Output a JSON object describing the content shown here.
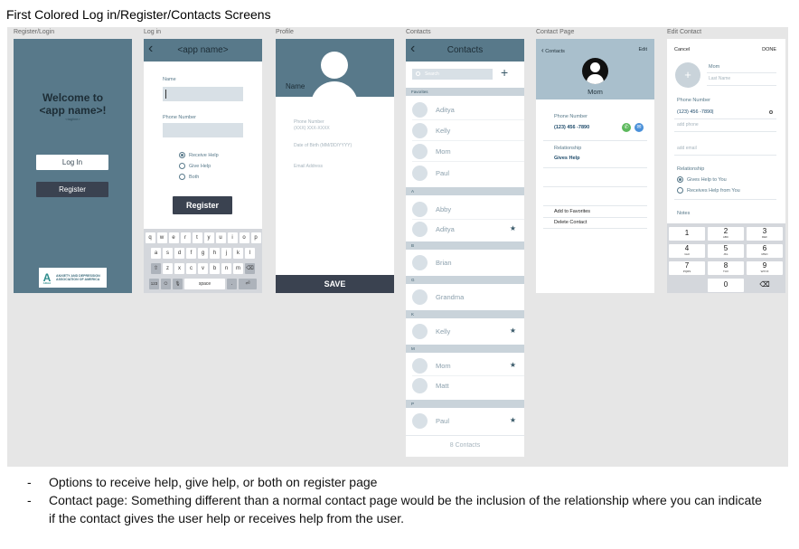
{
  "page_title": "First Colored Log in/Register/Contacts Screens",
  "frames": {
    "register_login": "Register/Login",
    "login": "Log in",
    "profile": "Profile",
    "contacts": "Contacts",
    "contact_page": "Contact Page",
    "edit_contact": "Edit Contact"
  },
  "register_login": {
    "welcome_line1": "Welcome to",
    "welcome_line2": "<app name>!",
    "tagline": "<tagline>",
    "login_button": "Log In",
    "register_button": "Register",
    "logo_mark": "A",
    "logo_text_1": "ANXIETY AND DEPRESSION",
    "logo_text_2": "ASSOCIATION OF AMERICA",
    "logo_caption": "ADAA"
  },
  "login": {
    "header_title": "<app name>",
    "name_label": "Name",
    "phone_label": "Phone Number",
    "radio_options": [
      "Receive Help",
      "Give Help",
      "Both"
    ],
    "register_button": "Register",
    "keyboard": {
      "row1": [
        "q",
        "w",
        "e",
        "r",
        "t",
        "y",
        "u",
        "i",
        "o",
        "p"
      ],
      "row2": [
        "a",
        "s",
        "d",
        "f",
        "g",
        "h",
        "j",
        "k",
        "l"
      ],
      "row3": [
        "z",
        "x",
        "c",
        "v",
        "b",
        "n",
        "m"
      ],
      "shift": "⇧",
      "delete": "⌫",
      "num": "123",
      "emoji": "☺",
      "mic": "🎙",
      "space": "space",
      "period": ".",
      "return": "⏎"
    }
  },
  "profile": {
    "name": "Name",
    "phone_label": "Phone Number",
    "phone_placeholder": "(XXX) XXX-XXXX",
    "dob": "Date of Birth (MM/DD/YYYY)",
    "email": "Email Address",
    "save_button": "SAVE"
  },
  "contacts": {
    "header_title": "Contacts",
    "search_placeholder": "Search",
    "add": "+",
    "sections": [
      {
        "letter": "Favorites",
        "rows": [
          {
            "name": "Aditya",
            "star": ""
          },
          {
            "name": "Kelly",
            "star": ""
          },
          {
            "name": "Mom",
            "star": ""
          },
          {
            "name": "Paul",
            "star": ""
          }
        ]
      },
      {
        "letter": "A",
        "rows": [
          {
            "name": "Abby",
            "star": ""
          },
          {
            "name": "Aditya",
            "star": "★"
          }
        ]
      },
      {
        "letter": "B",
        "rows": [
          {
            "name": "Brian",
            "star": ""
          }
        ]
      },
      {
        "letter": "G",
        "rows": [
          {
            "name": "Grandma",
            "star": ""
          }
        ]
      },
      {
        "letter": "K",
        "rows": [
          {
            "name": "Kelly",
            "star": "★"
          }
        ]
      },
      {
        "letter": "M",
        "rows": [
          {
            "name": "Mom",
            "star": "★"
          },
          {
            "name": "Matt",
            "star": ""
          }
        ]
      },
      {
        "letter": "P",
        "rows": [
          {
            "name": "Paul",
            "star": "★"
          }
        ]
      }
    ],
    "footer_count": "8 Contacts"
  },
  "contact_page": {
    "back": "Contacts",
    "edit": "Edit",
    "name": "Mom",
    "phone_label": "Phone Number",
    "phone": "(123) 456 -7890",
    "relationship_label": "Relationship",
    "relationship_value": "Gives Help",
    "add_favorites": "Add to Favorites",
    "delete": "Delete Contact",
    "call_icon_glyph": "✆",
    "message_icon_glyph": "✉"
  },
  "edit_contact": {
    "cancel": "Cancel",
    "done": "DONE",
    "first_name": "Mom",
    "last_name_placeholder": "Last Name",
    "phone_label": "Phone Number",
    "phone_value": "(123) 456 -7890|",
    "add_phone": "add phone",
    "add_email": "add email",
    "relationship_label": "Relationship",
    "relationship_options": [
      "Gives Help to You",
      "Receives Help from You"
    ],
    "notes_label": "Notes",
    "numpad": [
      {
        "d": "1",
        "l": ""
      },
      {
        "d": "2",
        "l": "ABC"
      },
      {
        "d": "3",
        "l": "DEF"
      },
      {
        "d": "4",
        "l": "GHI"
      },
      {
        "d": "5",
        "l": "JKL"
      },
      {
        "d": "6",
        "l": "MNO"
      },
      {
        "d": "7",
        "l": "PQRS"
      },
      {
        "d": "8",
        "l": "TUV"
      },
      {
        "d": "9",
        "l": "WXYZ"
      },
      {
        "d": "0",
        "l": ""
      },
      {
        "d": "⌫",
        "l": ""
      }
    ]
  },
  "notes": [
    "Options to receive help, give help, or both on register page",
    "Contact page: Something different than a normal contact page would be the inclusion of the relationship where you can indicate if the contact gives the user help or receives help from the user."
  ]
}
